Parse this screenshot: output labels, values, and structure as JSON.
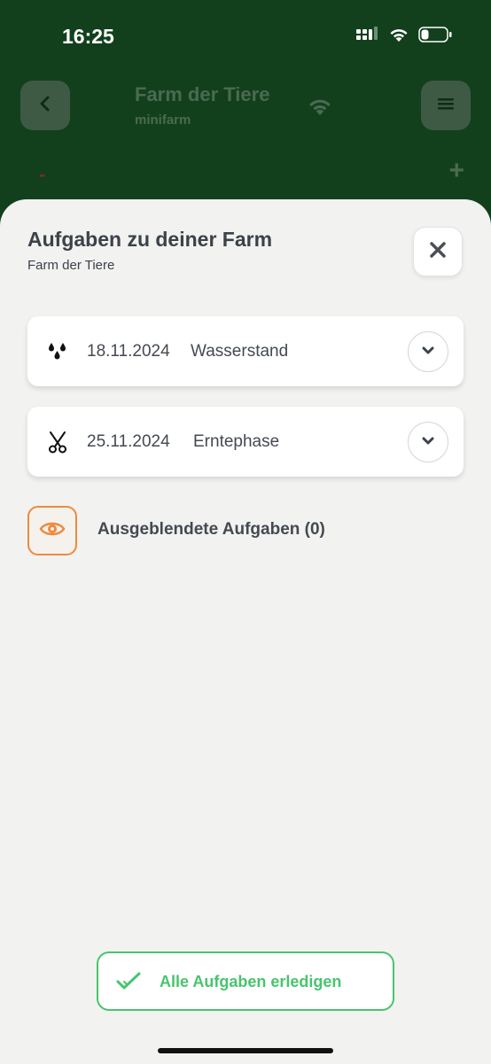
{
  "status_bar": {
    "time": "16:25",
    "icons": [
      "cellular-signal-icon",
      "wifi-icon",
      "battery-icon"
    ]
  },
  "background_header": {
    "title": "Farm der Tiere",
    "subtitle": "minifarm",
    "minus_label": "-",
    "plus_label": "+",
    "icons": [
      "back-icon",
      "connection-icon",
      "menu-icon"
    ]
  },
  "sheet": {
    "title": "Aufgaben zu deiner Farm",
    "subtitle": "Farm der Tiere",
    "tasks": [
      {
        "date": "18.11.2024",
        "name": "Wasserstand",
        "icon": "water-drops-icon"
      },
      {
        "date": "25.11.2024",
        "name": "Erntephase",
        "icon": "scissors-icon"
      }
    ],
    "hidden_tasks_label": "Ausgeblendete Aufgaben (0)",
    "complete_all_label": "Alle Aufgaben erledigen"
  },
  "colors": {
    "header_green": "#12401d",
    "sheet_bg": "#f2f2f0",
    "text_dark": "#3b424a",
    "accent_orange": "#ef8a3c",
    "accent_green": "#47c56d"
  }
}
